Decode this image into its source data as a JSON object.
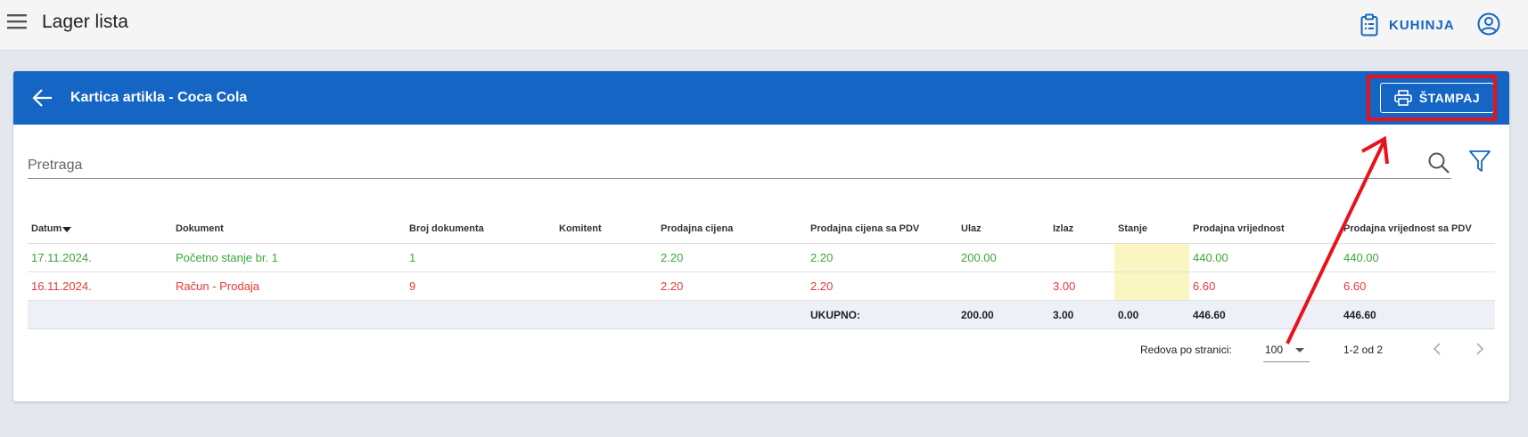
{
  "app": {
    "title": "Lager lista",
    "kitchen_label": "KUHINJA"
  },
  "card": {
    "title": "Kartica artikla - Coca Cola",
    "print_label": "ŠTAMPAJ"
  },
  "search": {
    "placeholder": "Pretraga"
  },
  "table": {
    "columns": [
      "Datum",
      "Dokument",
      "Broj dokumenta",
      "Komitent",
      "Prodajna cijena",
      "Prodajna cijena sa PDV",
      "Ulaz",
      "Izlaz",
      "Stanje",
      "Prodajna vrijednost",
      "Prodajna vrijednost sa PDV"
    ],
    "rows": [
      {
        "datum": "17.11.2024.",
        "dokument": "Početno stanje br. 1",
        "broj": "1",
        "komitent": "",
        "cijena": "2.20",
        "cijena_pdv": "2.20",
        "ulaz": "200.00",
        "izlaz": "",
        "stanje": "",
        "vrijednost": "440.00",
        "vrijednost_pdv": "440.00"
      },
      {
        "datum": "16.11.2024.",
        "dokument": "Račun - Prodaja",
        "broj": "9",
        "komitent": "",
        "cijena": "2.20",
        "cijena_pdv": "2.20",
        "ulaz": "",
        "izlaz": "3.00",
        "stanje": "",
        "vrijednost": "6.60",
        "vrijednost_pdv": "6.60"
      }
    ],
    "total": {
      "label": "UKUPNO:",
      "ulaz": "200.00",
      "izlaz": "3.00",
      "stanje": "0.00",
      "vrijednost": "446.60",
      "vrijednost_pdv": "446.60"
    }
  },
  "pager": {
    "rows_label": "Redova po stranici:",
    "rows_value": "100",
    "range": "1-2 od 2"
  },
  "colors": {
    "primary": "#1565c4",
    "accent_text": "#1565c0",
    "positive": "#3aa63a",
    "negative": "#e53935",
    "highlight": "#e8121b",
    "stanje_bg": "#fbf6c1"
  }
}
